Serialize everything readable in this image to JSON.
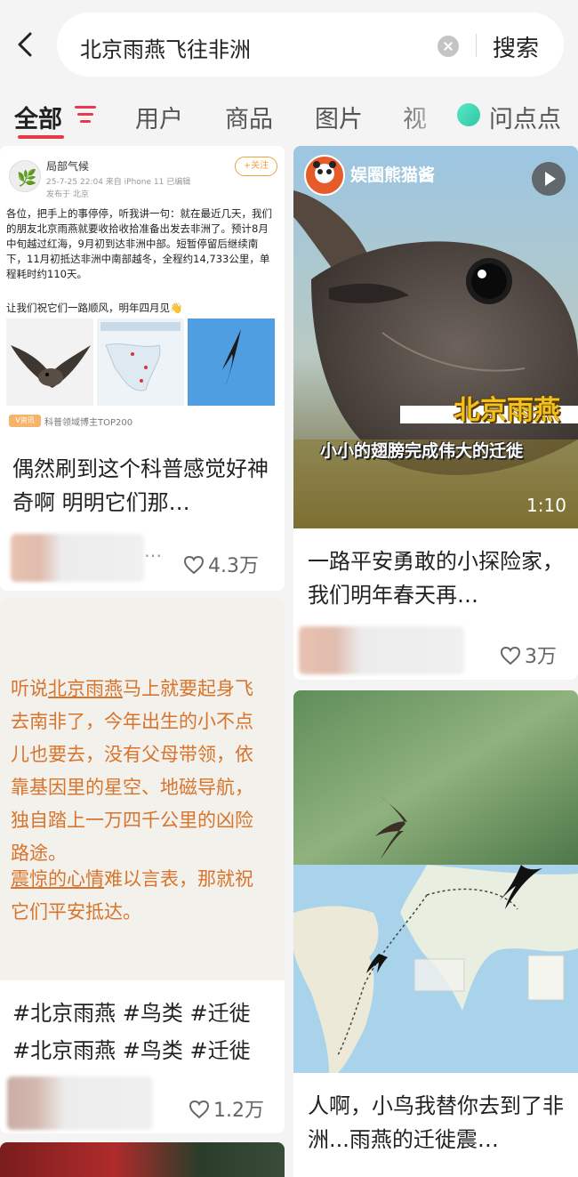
{
  "search": {
    "query": "北京雨燕飞往非洲",
    "button_label": "搜索"
  },
  "tabs": [
    {
      "label": "全部"
    },
    {
      "label": "用户"
    },
    {
      "label": "商品"
    },
    {
      "label": "图片"
    },
    {
      "label": "视"
    },
    {
      "label": "问点点"
    }
  ],
  "cards": {
    "weibo": {
      "post": {
        "name": "局部气候",
        "meta": "25-7-25 22:04  来自 iPhone 11  已编辑",
        "location": "发布于 北京",
        "follow": "+关注",
        "text": "各位，把手上的事停停，听我讲一句：就在最近几天，我们的朋友北京雨燕就要收拾收拾准备出发去非洲了。预计8月中旬越过红海，9月初到达非洲中部。短暂停留后继续南下，11月初抵达非洲中南部越冬，全程约14,733公里，单程耗时约110天。",
        "text2": "让我们祝它们一路顺风，明年四月见👋",
        "badge": "V资讯",
        "badge_text": "科普领域博主TOP200"
      },
      "title": "偶然刷到这个科普感觉好神奇啊 明明它们那…",
      "likes": "4.3万"
    },
    "video": {
      "channel": "娱圈熊猫酱",
      "caption_big": "北京雨燕",
      "caption_small": "小小的翅膀完成伟大的迁徙",
      "duration": "1:10",
      "title": "一路平安勇敢的小探险家，我们明年春天再…",
      "likes": "3万"
    },
    "note": {
      "p1_a": "听说",
      "p1_u": "北京雨燕",
      "p1_b": "马上就要起身飞去南非了，今年出生的小不点儿也要去，没有父母带领，依靠基因里的星空、地磁导航，独自踏上一万四千公里的凶险路途。",
      "p2_u": "震惊的心情",
      "p2_b": "难以言表，那就祝它们平安抵达。",
      "tags1": "#北京雨燕 #鸟类 #迁徙",
      "tags2": "#北京雨燕 #鸟类 #迁徙",
      "likes": "1.2万"
    },
    "map": {
      "title": "人啊，小鸟我替你去到了非洲...雨燕的迁徙震…"
    }
  }
}
